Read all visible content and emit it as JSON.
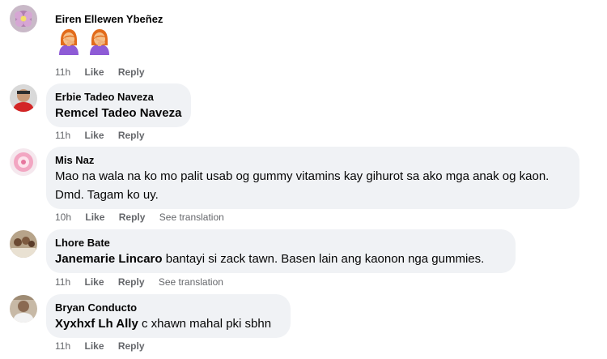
{
  "comments": [
    {
      "author": "Eiren Ellewen Ybeñez",
      "emojis": [
        "facepalm-emoji",
        "facepalm-emoji"
      ],
      "time": "11h",
      "like": "Like",
      "reply": "Reply"
    },
    {
      "author": "Erbie Tadeo Naveza",
      "tag": "Remcel Tadeo Naveza",
      "text": "",
      "time": "11h",
      "like": "Like",
      "reply": "Reply"
    },
    {
      "author": "Mis Naz",
      "text": "Mao na wala na ko mo palit usab og gummy vitamins kay gihurot sa ako mga anak og kaon. Dmd. Tagam ko uy.",
      "time": "10h",
      "like": "Like",
      "reply": "Reply",
      "translate": "See translation"
    },
    {
      "author": "Lhore Bate",
      "tag": "Janemarie Lincaro",
      "text": "bantayi si zack tawn. Basen lain ang kaonon nga gummies.",
      "time": "11h",
      "like": "Like",
      "reply": "Reply",
      "translate": "See translation"
    },
    {
      "author": "Bryan Conducto",
      "tag": "Xyxhxf Lh Ally",
      "text": "c xhawn mahal pki sbhn",
      "time": "11h",
      "like": "Like",
      "reply": "Reply"
    }
  ],
  "colors": {
    "bubble": "#f0f2f5",
    "secondary_text": "#65676b",
    "primary_text": "#050505"
  }
}
